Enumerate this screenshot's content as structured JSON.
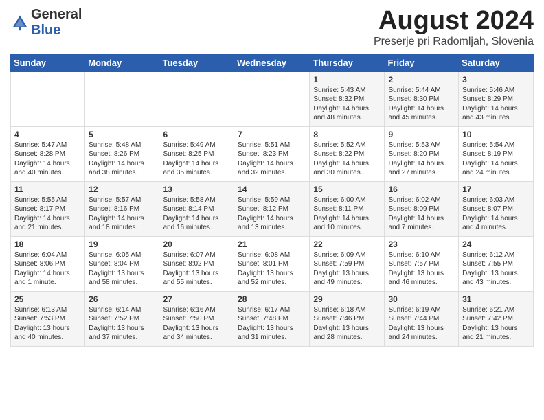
{
  "header": {
    "logo_general": "General",
    "logo_blue": "Blue",
    "month_title": "August 2024",
    "location": "Preserje pri Radomljah, Slovenia"
  },
  "days_of_week": [
    "Sunday",
    "Monday",
    "Tuesday",
    "Wednesday",
    "Thursday",
    "Friday",
    "Saturday"
  ],
  "weeks": [
    [
      {
        "day": "",
        "info": ""
      },
      {
        "day": "",
        "info": ""
      },
      {
        "day": "",
        "info": ""
      },
      {
        "day": "",
        "info": ""
      },
      {
        "day": "1",
        "info": "Sunrise: 5:43 AM\nSunset: 8:32 PM\nDaylight: 14 hours\nand 48 minutes."
      },
      {
        "day": "2",
        "info": "Sunrise: 5:44 AM\nSunset: 8:30 PM\nDaylight: 14 hours\nand 45 minutes."
      },
      {
        "day": "3",
        "info": "Sunrise: 5:46 AM\nSunset: 8:29 PM\nDaylight: 14 hours\nand 43 minutes."
      }
    ],
    [
      {
        "day": "4",
        "info": "Sunrise: 5:47 AM\nSunset: 8:28 PM\nDaylight: 14 hours\nand 40 minutes."
      },
      {
        "day": "5",
        "info": "Sunrise: 5:48 AM\nSunset: 8:26 PM\nDaylight: 14 hours\nand 38 minutes."
      },
      {
        "day": "6",
        "info": "Sunrise: 5:49 AM\nSunset: 8:25 PM\nDaylight: 14 hours\nand 35 minutes."
      },
      {
        "day": "7",
        "info": "Sunrise: 5:51 AM\nSunset: 8:23 PM\nDaylight: 14 hours\nand 32 minutes."
      },
      {
        "day": "8",
        "info": "Sunrise: 5:52 AM\nSunset: 8:22 PM\nDaylight: 14 hours\nand 30 minutes."
      },
      {
        "day": "9",
        "info": "Sunrise: 5:53 AM\nSunset: 8:20 PM\nDaylight: 14 hours\nand 27 minutes."
      },
      {
        "day": "10",
        "info": "Sunrise: 5:54 AM\nSunset: 8:19 PM\nDaylight: 14 hours\nand 24 minutes."
      }
    ],
    [
      {
        "day": "11",
        "info": "Sunrise: 5:55 AM\nSunset: 8:17 PM\nDaylight: 14 hours\nand 21 minutes."
      },
      {
        "day": "12",
        "info": "Sunrise: 5:57 AM\nSunset: 8:16 PM\nDaylight: 14 hours\nand 18 minutes."
      },
      {
        "day": "13",
        "info": "Sunrise: 5:58 AM\nSunset: 8:14 PM\nDaylight: 14 hours\nand 16 minutes."
      },
      {
        "day": "14",
        "info": "Sunrise: 5:59 AM\nSunset: 8:12 PM\nDaylight: 14 hours\nand 13 minutes."
      },
      {
        "day": "15",
        "info": "Sunrise: 6:00 AM\nSunset: 8:11 PM\nDaylight: 14 hours\nand 10 minutes."
      },
      {
        "day": "16",
        "info": "Sunrise: 6:02 AM\nSunset: 8:09 PM\nDaylight: 14 hours\nand 7 minutes."
      },
      {
        "day": "17",
        "info": "Sunrise: 6:03 AM\nSunset: 8:07 PM\nDaylight: 14 hours\nand 4 minutes."
      }
    ],
    [
      {
        "day": "18",
        "info": "Sunrise: 6:04 AM\nSunset: 8:06 PM\nDaylight: 14 hours\nand 1 minute."
      },
      {
        "day": "19",
        "info": "Sunrise: 6:05 AM\nSunset: 8:04 PM\nDaylight: 13 hours\nand 58 minutes."
      },
      {
        "day": "20",
        "info": "Sunrise: 6:07 AM\nSunset: 8:02 PM\nDaylight: 13 hours\nand 55 minutes."
      },
      {
        "day": "21",
        "info": "Sunrise: 6:08 AM\nSunset: 8:01 PM\nDaylight: 13 hours\nand 52 minutes."
      },
      {
        "day": "22",
        "info": "Sunrise: 6:09 AM\nSunset: 7:59 PM\nDaylight: 13 hours\nand 49 minutes."
      },
      {
        "day": "23",
        "info": "Sunrise: 6:10 AM\nSunset: 7:57 PM\nDaylight: 13 hours\nand 46 minutes."
      },
      {
        "day": "24",
        "info": "Sunrise: 6:12 AM\nSunset: 7:55 PM\nDaylight: 13 hours\nand 43 minutes."
      }
    ],
    [
      {
        "day": "25",
        "info": "Sunrise: 6:13 AM\nSunset: 7:53 PM\nDaylight: 13 hours\nand 40 minutes."
      },
      {
        "day": "26",
        "info": "Sunrise: 6:14 AM\nSunset: 7:52 PM\nDaylight: 13 hours\nand 37 minutes."
      },
      {
        "day": "27",
        "info": "Sunrise: 6:16 AM\nSunset: 7:50 PM\nDaylight: 13 hours\nand 34 minutes."
      },
      {
        "day": "28",
        "info": "Sunrise: 6:17 AM\nSunset: 7:48 PM\nDaylight: 13 hours\nand 31 minutes."
      },
      {
        "day": "29",
        "info": "Sunrise: 6:18 AM\nSunset: 7:46 PM\nDaylight: 13 hours\nand 28 minutes."
      },
      {
        "day": "30",
        "info": "Sunrise: 6:19 AM\nSunset: 7:44 PM\nDaylight: 13 hours\nand 24 minutes."
      },
      {
        "day": "31",
        "info": "Sunrise: 6:21 AM\nSunset: 7:42 PM\nDaylight: 13 hours\nand 21 minutes."
      }
    ]
  ]
}
